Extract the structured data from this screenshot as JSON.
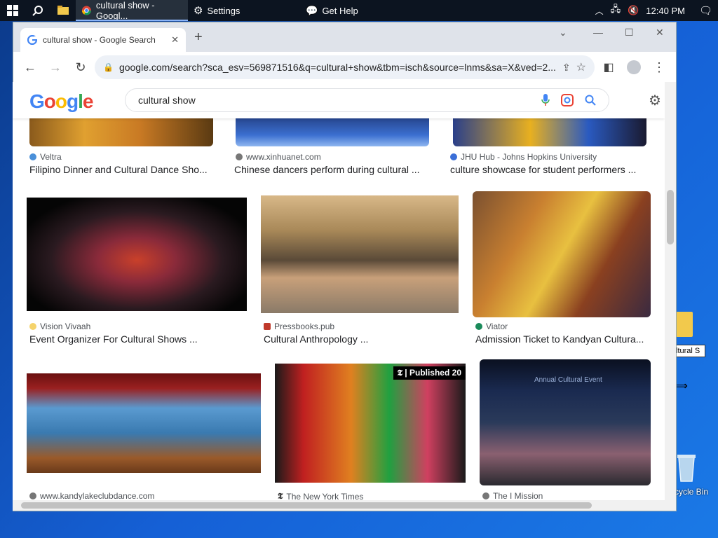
{
  "taskbar": {
    "tasks": [
      {
        "label": "cultural show - Googl...",
        "icon": "chrome-icon"
      },
      {
        "label": "Settings",
        "icon": "gear-icon"
      },
      {
        "label": "Get Help",
        "icon": "help-icon"
      }
    ],
    "clock": "12:40 PM"
  },
  "browser": {
    "tab_title": "cultural show - Google Search",
    "url": "google.com/search?sca_esv=569871516&q=cultural+show&tbm=isch&source=lnms&sa=X&ved=2..."
  },
  "google": {
    "logo": [
      "G",
      "o",
      "o",
      "g",
      "l",
      "e"
    ],
    "logo_colors": [
      "#4285F4",
      "#EA4335",
      "#FBBC05",
      "#4285F4",
      "#34A853",
      "#EA4335"
    ],
    "query": "cultural show"
  },
  "results": [
    {
      "source": "Veltra",
      "caption": "Filipino Dinner and Cultural Dance Sho...",
      "fav": "#4a90d9"
    },
    {
      "source": "www.xinhuanet.com",
      "caption": "Chinese dancers perform during cultural ...",
      "fav": "#777777"
    },
    {
      "source": "JHU Hub - Johns Hopkins University",
      "caption": "culture showcase for student performers ...",
      "fav": "#3b6fd8"
    },
    {
      "source": "Vision Vivaah",
      "caption": "Event Organizer For Cultural Shows ...",
      "fav": "#f5d36b"
    },
    {
      "source": "Pressbooks.pub",
      "caption": "Cultural Anthropology ...",
      "fav": "#c0392b"
    },
    {
      "source": "Viator",
      "caption": "Admission Ticket to Kandyan Cultura...",
      "fav": "#1a8a5a"
    },
    {
      "source": "www.kandylakeclubdance.com",
      "caption": "",
      "fav": "#777777"
    },
    {
      "source": "The New York Times",
      "caption": "",
      "fav": "#333333"
    },
    {
      "source": "The I Mission",
      "caption": "",
      "fav": "#777777"
    }
  ],
  "image_overlays": {
    "nyt_badge": "Published 20",
    "mission_banner": "Annual Cultural Event"
  },
  "desktop": {
    "file_label": "ltural S",
    "recycle_bin": "cycle Bin"
  }
}
